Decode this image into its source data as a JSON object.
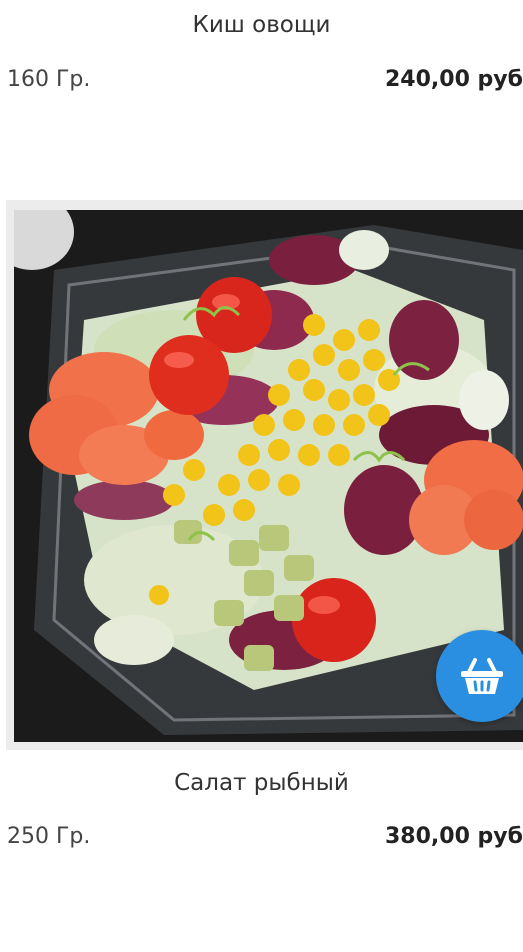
{
  "products": [
    {
      "name": "Киш овощи",
      "weight": "160 Гр.",
      "price": "240,00 руб"
    },
    {
      "name": "Салат рыбный",
      "weight": "250 Гр.",
      "price": "380,00 руб",
      "cart_icon": "basket-icon"
    }
  ],
  "colors": {
    "cart_button": "#2a8fe0",
    "text": "#333333",
    "frame": "#ececec"
  }
}
